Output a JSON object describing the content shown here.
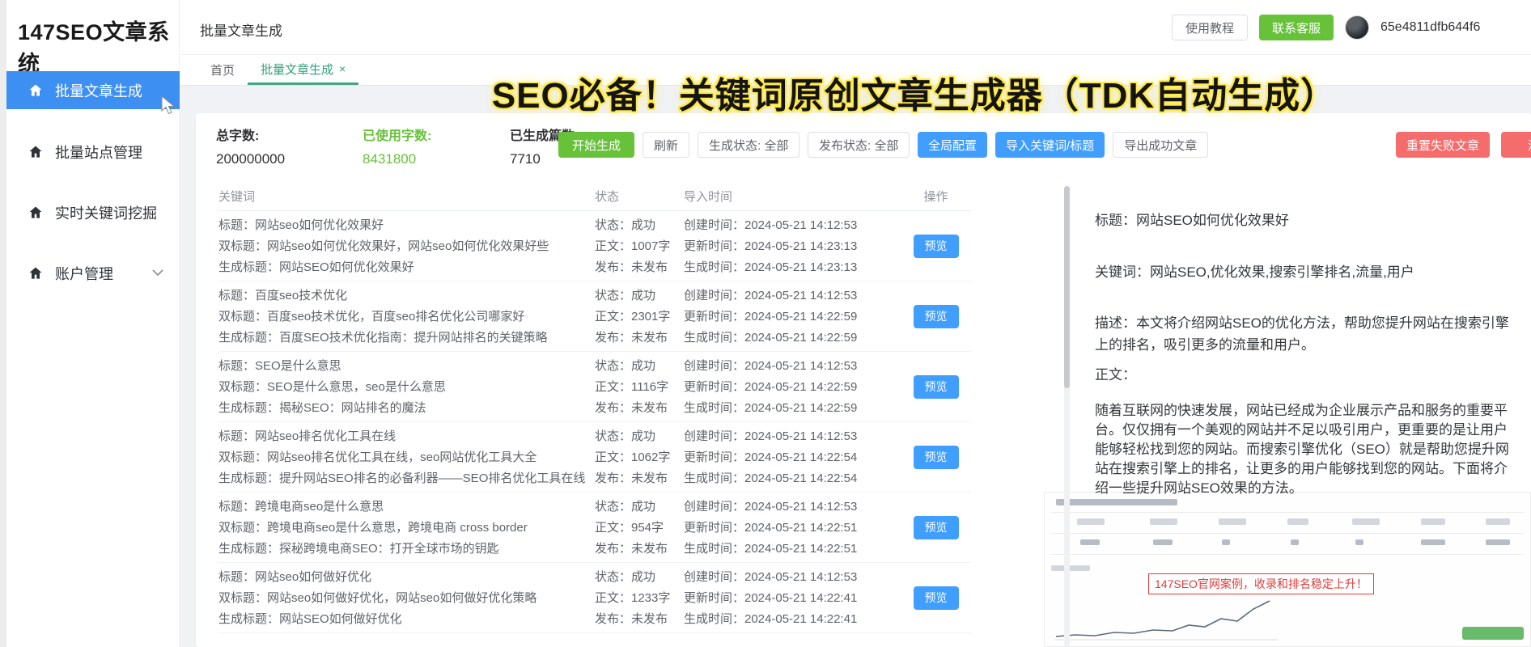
{
  "app": {
    "logo": "147SEO文章系统"
  },
  "sidebar": {
    "items": [
      {
        "label": "批量文章生成"
      },
      {
        "label": "批量站点管理"
      },
      {
        "label": "实时关键词挖掘"
      },
      {
        "label": "账户管理"
      }
    ]
  },
  "topbar": {
    "breadcrumb": "批量文章生成",
    "tutorial": "使用教程",
    "contact": "联系客服",
    "user_id": "65e4811dfb644f6"
  },
  "tabs": {
    "home": "首页",
    "current": "批量文章生成",
    "close_glyph": "×"
  },
  "overlay": {
    "headline": "SEO必备！关键词原创文章生成器（TDK自动生成）"
  },
  "stats": {
    "total_label": "总字数:",
    "total_value": "200000000",
    "used_label": "已使用字数:",
    "used_value": "8431800",
    "generated_label": "已生成篇数:",
    "generated_value": "7710"
  },
  "toolbar": {
    "start": "开始生成",
    "refresh": "刷新",
    "gen_status": "生成状态: 全部",
    "pub_status": "发布状态: 全部",
    "global_config": "全局配置",
    "import_kw": "导入关键词/标题",
    "export_ok": "导出成功文章",
    "reset_failed": "重置失败文章",
    "clear": "清空"
  },
  "table": {
    "headers": {
      "keyword": "关键词",
      "status": "状态",
      "import_time": "导入时间",
      "action": "操作"
    },
    "preview_btn": "预览",
    "rows": [
      {
        "title": "标题：网站seo如何优化效果好",
        "double_title": "双标题：网站seo如何优化效果好，网站seo如何优化效果好些",
        "gen_title": "生成标题：网站SEO如何优化效果好",
        "status": "状态：成功",
        "words": "正文：1007字",
        "publish": "发布：未发布",
        "created": "创建时间：2024-05-21 14:12:53",
        "updated": "更新时间：2024-05-21 14:23:13",
        "generated": "生成时间：2024-05-21 14:23:13"
      },
      {
        "title": "标题：百度seo技术优化",
        "double_title": "双标题：百度seo技术优化，百度seo排名优化公司哪家好",
        "gen_title": "生成标题：百度SEO技术优化指南：提升网站排名的关键策略",
        "status": "状态：成功",
        "words": "正文：2301字",
        "publish": "发布：未发布",
        "created": "创建时间：2024-05-21 14:12:53",
        "updated": "更新时间：2024-05-21 14:22:59",
        "generated": "生成时间：2024-05-21 14:22:59"
      },
      {
        "title": "标题：SEO是什么意思",
        "double_title": "双标题：SEO是什么意思，seo是什么意思",
        "gen_title": "生成标题：揭秘SEO：网站排名的魔法",
        "status": "状态：成功",
        "words": "正文：1116字",
        "publish": "发布：未发布",
        "created": "创建时间：2024-05-21 14:12:53",
        "updated": "更新时间：2024-05-21 14:22:59",
        "generated": "生成时间：2024-05-21 14:22:59"
      },
      {
        "title": "标题：网站seo排名优化工具在线",
        "double_title": "双标题：网站seo排名优化工具在线，seo网站优化工具大全",
        "gen_title": "生成标题：提升网站SEO排名的必备利器——SEO排名优化工具在线",
        "status": "状态：成功",
        "words": "正文：1062字",
        "publish": "发布：未发布",
        "created": "创建时间：2024-05-21 14:12:53",
        "updated": "更新时间：2024-05-21 14:22:54",
        "generated": "生成时间：2024-05-21 14:22:54"
      },
      {
        "title": "标题：跨境电商seo是什么意思",
        "double_title": "双标题：跨境电商seo是什么意思，跨境电商 cross border",
        "gen_title": "生成标题：探秘跨境电商SEO：打开全球市场的钥匙",
        "status": "状态：成功",
        "words": "正文：954字",
        "publish": "发布：未发布",
        "created": "创建时间：2024-05-21 14:12:53",
        "updated": "更新时间：2024-05-21 14:22:51",
        "generated": "生成时间：2024-05-21 14:22:51"
      },
      {
        "title": "标题：网站seo如何做好优化",
        "double_title": "双标题：网站seo如何做好优化，网站seo如何做好优化策略",
        "gen_title": "生成标题：网站SEO如何做好优化",
        "status": "状态：成功",
        "words": "正文：1233字",
        "publish": "发布：未发布",
        "created": "创建时间：2024-05-21 14:12:53",
        "updated": "更新时间：2024-05-21 14:22:41",
        "generated": "生成时间：2024-05-21 14:22:41"
      }
    ]
  },
  "preview": {
    "title": "标题：网站SEO如何优化效果好",
    "keywords": "关键词：网站SEO,优化效果,搜索引擎排名,流量,用户",
    "description": "描述：本文将介绍网站SEO的优化方法，帮助您提升网站在搜索引擎上的排名，吸引更多的流量和用户。",
    "body_label": "正文：",
    "body": "随着互联网的快速发展，网站已经成为企业展示产品和服务的重要平台。仅仅拥有一个美观的网站并不足以吸引用户，更重要的是让用户能够轻松找到您的网站。而搜索引擎优化（SEO）就是帮助您提升网站在搜索引擎上的排名，让更多的用户能够找到您的网站。下面将介绍一些提升网站SEO效果的方法。",
    "screenshot_annotation": "147SEO官网案例，收录和排名稳定上升！"
  },
  "colors": {
    "primary": "#409eff",
    "sidebar_active": "#3e8ff2",
    "success": "#67c23a",
    "danger": "#f56c6c",
    "tab_active": "#3fa87f",
    "headline_glow": "#ffe94d",
    "annotation_red": "#e23b3b"
  }
}
